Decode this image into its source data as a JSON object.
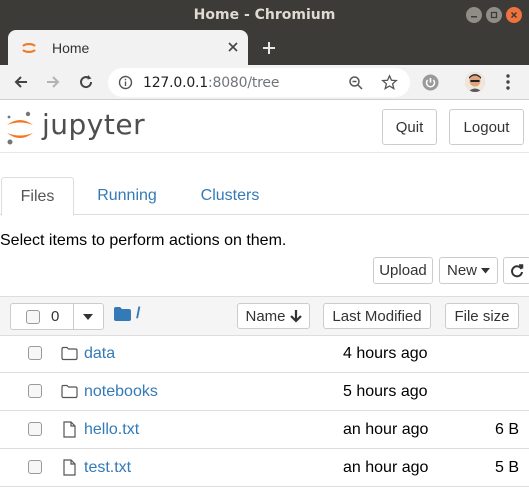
{
  "window": {
    "title": "Home - Chromium"
  },
  "browser": {
    "tab_title": "Home",
    "url_host": "127.0.0.1",
    "url_rest": ":8080/tree"
  },
  "jupyter": {
    "logo_text": "jupyter",
    "quit_label": "Quit",
    "logout_label": "Logout",
    "tabs": [
      "Files",
      "Running",
      "Clusters"
    ],
    "active_tab": "Files",
    "hint": "Select items to perform actions on them.",
    "upload_label": "Upload",
    "new_label": "New",
    "selected_count": "0",
    "breadcrumb": "/",
    "sort": {
      "name": "Name",
      "modified": "Last Modified",
      "size": "File size"
    },
    "files": [
      {
        "type": "folder",
        "name": "data",
        "modified": "4 hours ago",
        "size": ""
      },
      {
        "type": "folder",
        "name": "notebooks",
        "modified": "5 hours ago",
        "size": ""
      },
      {
        "type": "file",
        "name": "hello.txt",
        "modified": "an hour ago",
        "size": "6 B"
      },
      {
        "type": "file",
        "name": "test.txt",
        "modified": "an hour ago",
        "size": "5 B"
      }
    ]
  },
  "colors": {
    "accent": "#337ab7",
    "jupyter_orange": "#f37726",
    "titlebar": "#3c3b37"
  }
}
